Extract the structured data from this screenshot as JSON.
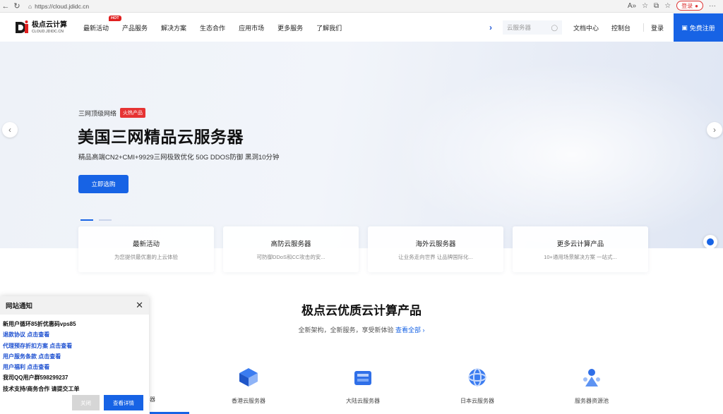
{
  "browser": {
    "url": "https://cloud.jdidc.cn",
    "login_label": "登录",
    "read_aloud": "A»"
  },
  "header": {
    "logo_text": "极点云计算",
    "logo_sub": "CLOUD.JDIDC.CN",
    "hot_badge": "HOT",
    "nav": [
      "最新活动",
      "产品服务",
      "解决方案",
      "生态合作",
      "应用市场",
      "更多服务",
      "了解我们"
    ],
    "search_placeholder": "云服务器",
    "docs": "文档中心",
    "console": "控制台",
    "login": "登录",
    "register": "免费注册"
  },
  "hero": {
    "tagline": "三网顶级网络",
    "tag": "火热产品",
    "title": "美国三网精品云服务器",
    "subtitle": "精品高端CN2+CMI+9929三网极致优化 50G DDOS防御 黑洞10分钟",
    "cta": "立即选购"
  },
  "cards": [
    {
      "title": "最新活动",
      "desc": "为您提供最优惠的上云体验"
    },
    {
      "title": "高防云服务器",
      "desc": "可防御DDoS和CC攻击的安..."
    },
    {
      "title": "海外云服务器",
      "desc": "让业务走向世界 让品牌国际化..."
    },
    {
      "title": "更多云计算产品",
      "desc": "10+通用场景解决方案 一站式..."
    }
  ],
  "section": {
    "title": "极点云优质云计算产品",
    "subtitle": "全新架构，全新服务，享受新体验",
    "link": "查看全部 ›"
  },
  "products": [
    {
      "label": "香港云服务器"
    },
    {
      "label": "大陆云服务器"
    },
    {
      "label": "日本云服务器"
    },
    {
      "label": "服务器资源池"
    }
  ],
  "partial_label": "器",
  "notice": {
    "title": "网站通知",
    "lines": [
      {
        "text": "新用户循环85折优惠码vps85",
        "link": false
      },
      {
        "text": "退款协议 点击查看",
        "link": true
      },
      {
        "text": "代理预存折扣方案 点击查看",
        "link": true
      },
      {
        "text": "用户服务条款 点击查看",
        "link": true
      },
      {
        "text": "用户福利 点击查看",
        "link": true
      },
      {
        "text": "我司QQ用户群598299237",
        "link": false
      },
      {
        "text": "技术支持/商务合作 请提交工单",
        "link": false
      }
    ],
    "close_btn": "关闭",
    "view_btn": "查看详情"
  }
}
